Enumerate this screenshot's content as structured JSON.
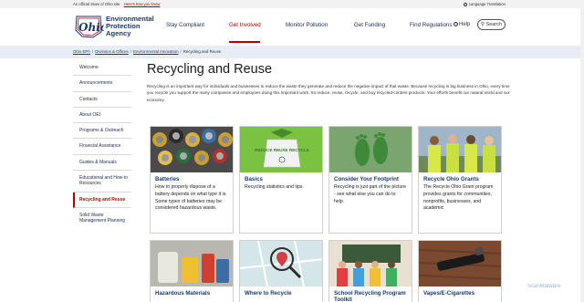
{
  "topbar": {
    "official_text": "An official State of Ohio site.",
    "how_link": "Here's how you know",
    "language": "Language Translation"
  },
  "logo": {
    "script_text": "Ohio",
    "line1": "Environmental",
    "line2": "Protection",
    "line3": "Agency"
  },
  "nav": {
    "items": [
      "Stay Compliant",
      "Get Involved",
      "Monitor Pollution",
      "Get Funding",
      "Find Regulations"
    ],
    "help": "Help",
    "search": "Search",
    "active_color": "#b30000"
  },
  "breadcrumb": {
    "items": [
      "Ohio EPA",
      "Divisions & Offices",
      "Environmental Innovation"
    ],
    "current": "Recycling and Reuse"
  },
  "sidebar": {
    "items": [
      "Welcome",
      "Announcements",
      "Contacts",
      "About OEI",
      "Programs & Outreach",
      "Financial Assistance",
      "Guides & Manuals",
      "Educational and How-to Resources",
      "Recycling and Reuse",
      "Solid Waste Management Planning"
    ],
    "active_index": 8
  },
  "main": {
    "title": "Recycling and Reuse",
    "intro": "Recycling is an important way for individuals and businesses to reduce the waste they generate and reduce the negative impact of that waste. Because recycling is big business in Ohio, every time you recycle you support the many companies and employees doing this important work. So reduce, reuse, recycle, and buy recycled-content products. Your efforts benefit our natural world and our economy."
  },
  "cards": [
    {
      "title": "Batteries",
      "desc": "How to properly dispose of a battery depends on what type it is. Some types of batteries may be considered hazardous waste.",
      "image": "batteries-photo"
    },
    {
      "title": "Basics",
      "desc": "Recycling statistics and tips.",
      "image": "reduce-reuse-recycle-graphic",
      "image_text": "REDUCE REUSE RECYCLE"
    },
    {
      "title": "Consider Your Footprint",
      "desc": "Recycling is just part of the picture - see what else you can do to help.",
      "image": "green-footprints-photo"
    },
    {
      "title": "Recycle Ohio Grants",
      "desc": "The Recycle Ohio Grant program provides grants for communities, nonprofits, businesses, and academic",
      "image": "grant-team-photo"
    },
    {
      "title": "Hazardous Materials",
      "desc": "",
      "image": "hazardous-containers-photo"
    },
    {
      "title": "Where to Recycle",
      "desc": "",
      "image": "map-pin-photo"
    },
    {
      "title": "School Recycling Program Toolkit",
      "desc": "",
      "image": "school-children-photo"
    },
    {
      "title": "Vapes/E-Cigarettes",
      "desc": "",
      "image": "vape-pen-photo"
    }
  ],
  "watermark": "ScanMalware"
}
